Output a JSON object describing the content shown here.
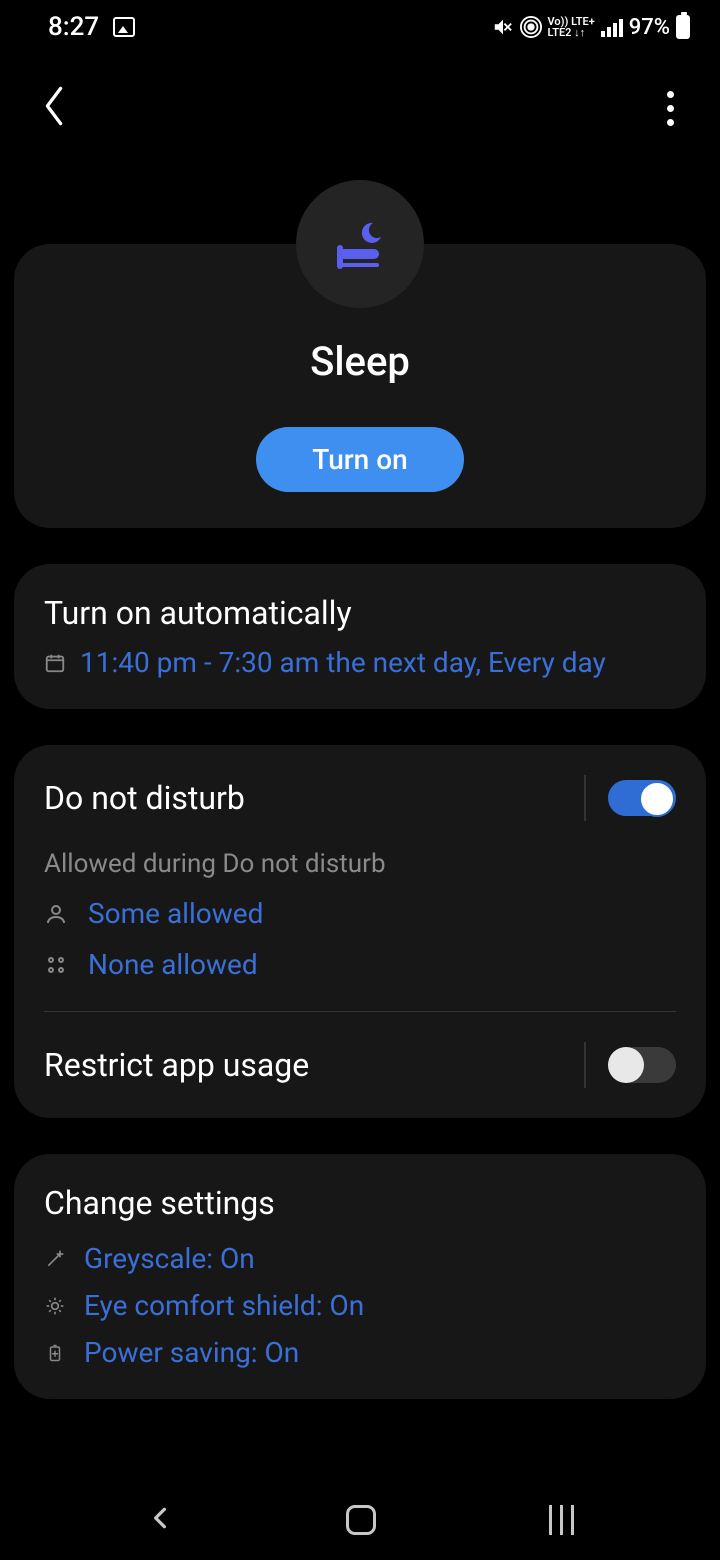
{
  "status": {
    "time": "8:27",
    "battery": "97%",
    "lte_top": "Vo)) LTE+",
    "lte_bottom": "LTE2 ↓↑"
  },
  "hero": {
    "title": "Sleep",
    "button": "Turn on"
  },
  "auto": {
    "title": "Turn on automatically",
    "schedule": "11:40 pm - 7:30 am the next day, Every day"
  },
  "dnd": {
    "title": "Do not disturb",
    "subtitle": "Allowed during Do not disturb",
    "contacts": "Some allowed",
    "apps": "None allowed",
    "enabled": true
  },
  "restrict": {
    "title": "Restrict app usage",
    "enabled": false
  },
  "change": {
    "title": "Change settings",
    "greyscale": "Greyscale: On",
    "eye": "Eye comfort shield: On",
    "power": "Power saving: On"
  }
}
